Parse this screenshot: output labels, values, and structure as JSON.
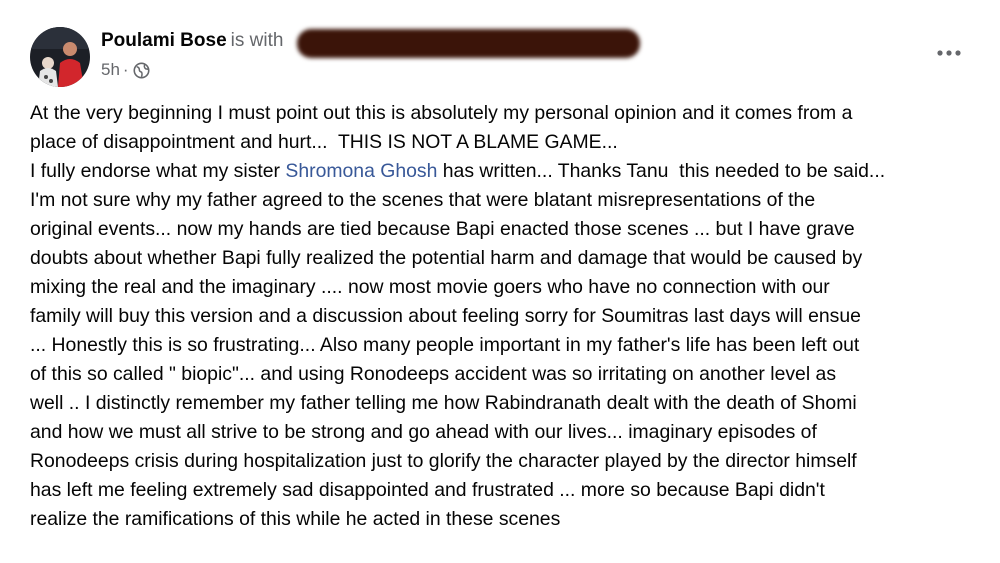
{
  "post": {
    "author_name": "Poulami Bose",
    "with_text": "is with",
    "time": "5h",
    "separator": "·",
    "privacy_icon": "globe-icon",
    "more_icon": "more-horizontal-icon",
    "body": {
      "line_1": "At the very beginning I must point out this is absolutely my personal opinion and it comes from a",
      "line_2": "place of disappointment and hurt...  THIS IS NOT A BLAME GAME...",
      "line_3_before": "I fully endorse what my sister ",
      "line_3_mention": "Shromona Ghosh",
      "line_3_after": " has written... Thanks Tanu  this needed to be said...",
      "line_4": "I'm not sure why my father agreed to the scenes that were blatant misrepresentations of the",
      "line_5": "original events... now my hands are tied because Bapi enacted those scenes ... but I have grave",
      "line_6": "doubts about whether Bapi fully realized the potential harm and damage that would be caused by",
      "line_7": "mixing the real and the imaginary .... now most movie goers who have no connection with our",
      "line_8": "family will buy this version and a discussion about feeling sorry for Soumitras last days will ensue",
      "line_9": "... Honestly this is so frustrating... Also many people important in my father's life has been left out",
      "line_10": "of this so called \" biopic\"... and using Ronodeeps accident was so irritating on another level as",
      "line_11": "well .. I distinctly remember my father telling me how Rabindranath dealt with the death of Shomi",
      "line_12": "and how we must all strive to be strong and go ahead with our lives... imaginary episodes of",
      "line_13": "Ronodeeps crisis during hospitalization just to glorify the character played by the director himself",
      "line_14": "has left me feeling extremely sad disappointed and frustrated ... more so because Bapi didn't",
      "line_15": "realize the ramifications of this while he acted in these scenes"
    }
  },
  "colors": {
    "text": "#050505",
    "secondary": "#65676b",
    "mention": "#385898",
    "redaction": "#3b1409"
  }
}
